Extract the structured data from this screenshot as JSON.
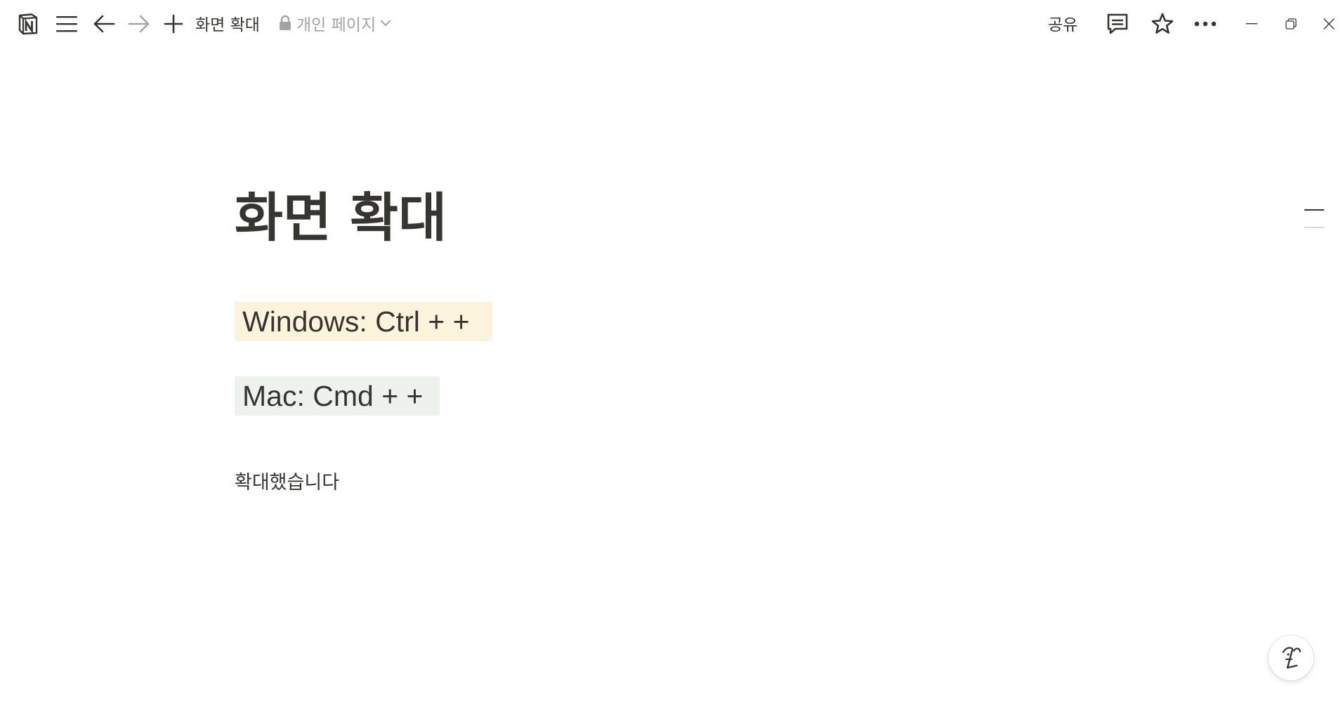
{
  "topbar": {
    "app_icon": "notion-logo-icon",
    "menu_icon": "hamburger-menu-icon",
    "back_icon": "arrow-left-icon",
    "forward_icon": "arrow-right-icon",
    "new_page_icon": "plus-icon",
    "breadcrumb_title": "화면 확대",
    "privacy_icon": "lock-icon",
    "privacy_label": "개인 페이지",
    "privacy_dropdown_icon": "chevron-down-icon",
    "share_label": "공유",
    "comments_icon": "comment-icon",
    "favorite_icon": "star-icon",
    "more_icon": "ellipsis-icon",
    "minimize_icon": "window-minimize-icon",
    "restore_icon": "window-restore-icon",
    "close_icon": "window-close-icon"
  },
  "page": {
    "title": "화면 확대",
    "blocks": [
      {
        "type": "heading",
        "text": "Windows: Ctrl + +",
        "background": "#fbf3db"
      },
      {
        "type": "heading",
        "text": "Mac: Cmd + +",
        "background": "#edf3ec"
      },
      {
        "type": "paragraph",
        "text": "확대했습니다"
      }
    ]
  },
  "outline": {
    "icon": "table-of-contents-icon",
    "line_colors": [
      "#37352f",
      "#d9d9d6"
    ]
  },
  "help": {
    "icon": "notion-ai-face-icon"
  }
}
